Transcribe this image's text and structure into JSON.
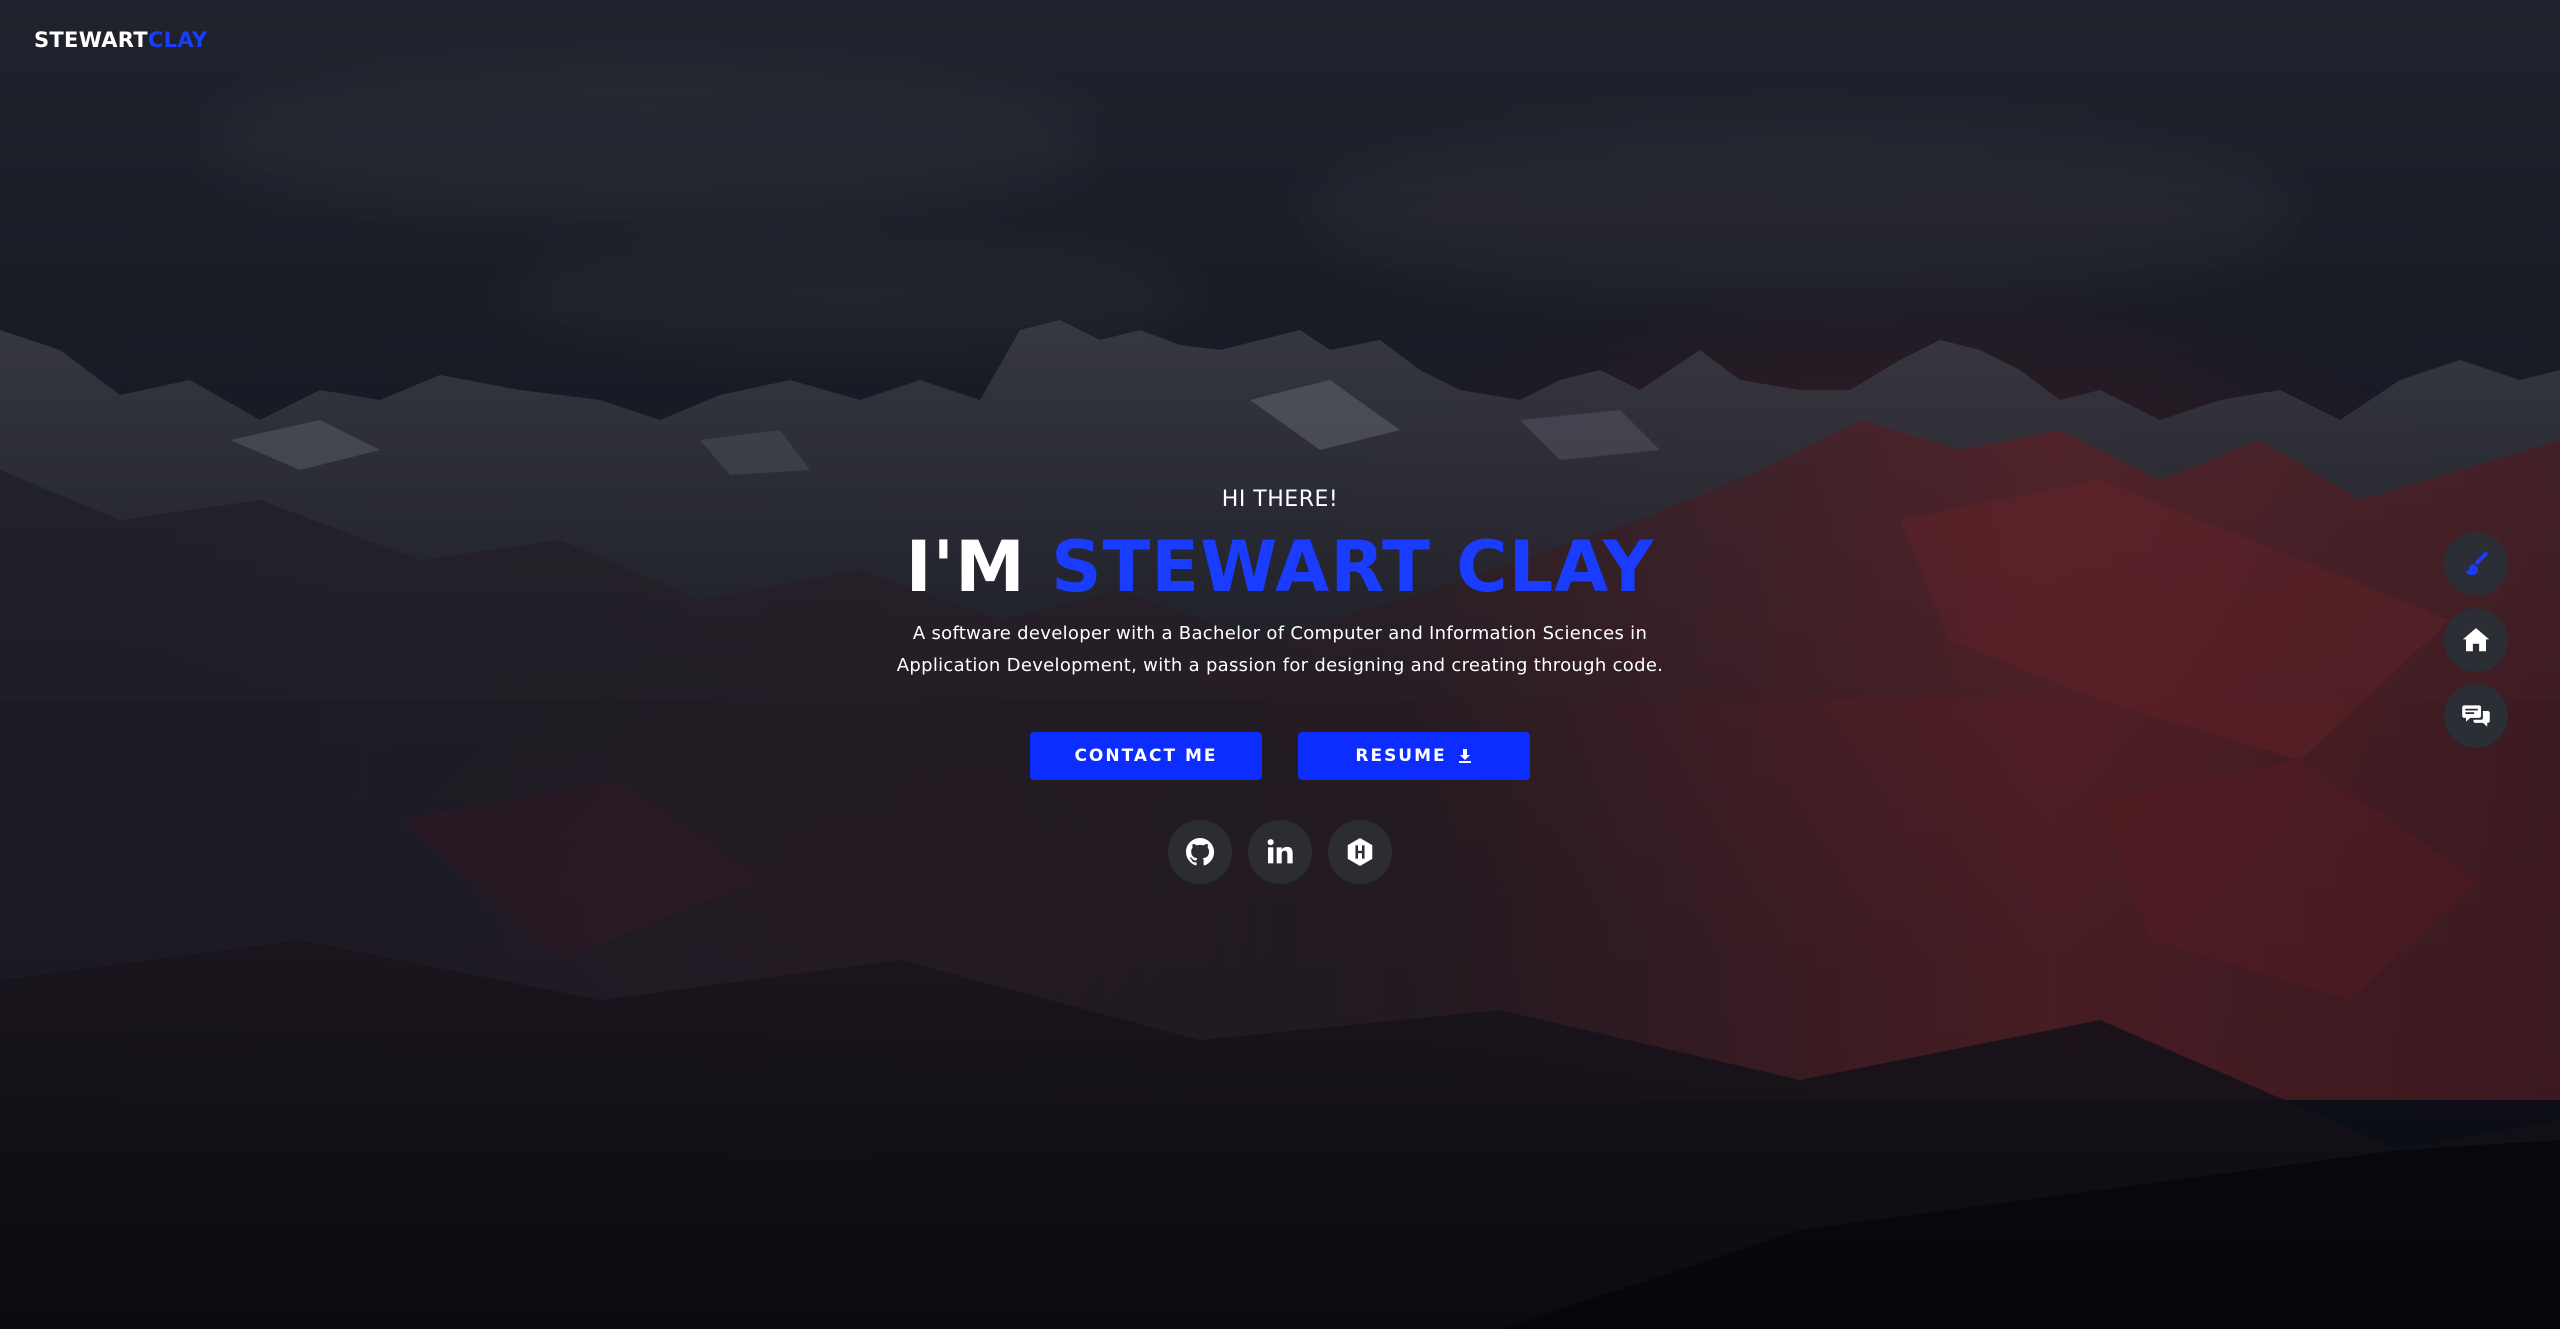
{
  "brand": {
    "part1": "STEWART",
    "part2": "CLAY"
  },
  "hero": {
    "greeting": "HI THERE!",
    "headline_prefix": "I'M",
    "headline_name": "STEWART CLAY",
    "tagline": "A software developer with a Bachelor of Computer and Information Sciences in Application Development, with a passion for designing and creating through code."
  },
  "actions": {
    "contact_label": "CONTACT ME",
    "resume_label": "RESUME",
    "resume_icon": "download-icon"
  },
  "socials": [
    {
      "name": "github",
      "icon": "github-icon"
    },
    {
      "name": "linkedin",
      "icon": "linkedin-icon"
    },
    {
      "name": "hackerrank",
      "icon": "hackerrank-icon"
    }
  ],
  "side_nav": [
    {
      "name": "theme",
      "icon": "paint-brush-icon"
    },
    {
      "name": "home",
      "icon": "home-icon"
    },
    {
      "name": "contact",
      "icon": "chat-icon"
    }
  ],
  "colors": {
    "accent": "#1a3cff",
    "button": "#0d2cff",
    "text": "#ffffff",
    "icon_bg": "#2c2d33"
  }
}
